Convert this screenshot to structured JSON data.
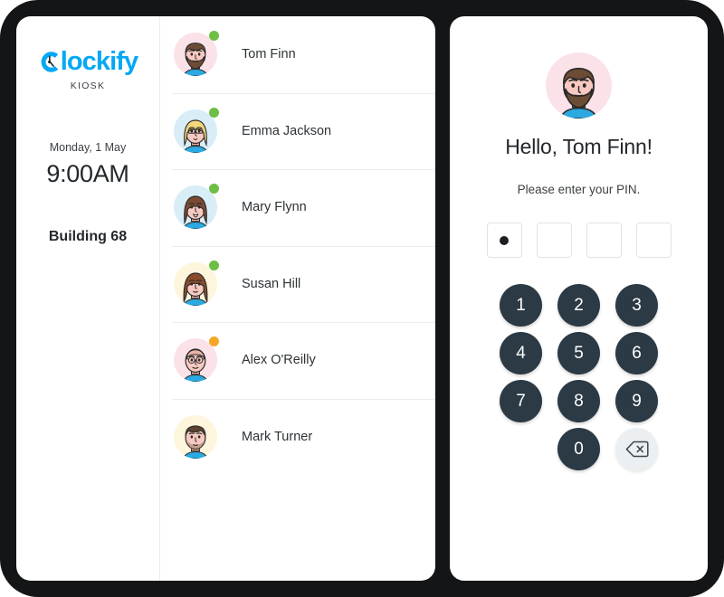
{
  "brand": {
    "logo_text": "lockify",
    "logo_mark": "clockify-clock-icon",
    "sub_label": "KIOSK",
    "accent_color": "#03a9f4"
  },
  "info_pane": {
    "date": "Monday, 1 May",
    "time": "9:00AM",
    "location": "Building 68"
  },
  "user_list": {
    "users": [
      {
        "name": "Tom Finn",
        "status": "online",
        "status_color": "#6dbe45",
        "avatar_bg": "#fbe2e9",
        "avatar": "avatar-bearded-man-brown-hair"
      },
      {
        "name": "Emma Jackson",
        "status": "online",
        "status_color": "#6dbe45",
        "avatar_bg": "#d9edf7",
        "avatar": "avatar-blonde-woman-glasses"
      },
      {
        "name": "Mary Flynn",
        "status": "online",
        "status_color": "#6dbe45",
        "avatar_bg": "#d9edf7",
        "avatar": "avatar-brown-haired-woman"
      },
      {
        "name": "Susan Hill",
        "status": "online",
        "status_color": "#6dbe45",
        "avatar_bg": "#fdf6dd",
        "avatar": "avatar-auburn-haired-woman"
      },
      {
        "name": "Alex O'Reilly",
        "status": "away",
        "status_color": "#f5a623",
        "avatar_bg": "#fbe2e9",
        "avatar": "avatar-bald-man-glasses"
      },
      {
        "name": "Mark Turner",
        "status": "offline",
        "status_color": "",
        "avatar_bg": "#fdf6dd",
        "avatar": "avatar-short-hair-man-stubble"
      }
    ]
  },
  "pin_panel": {
    "avatar": "avatar-bearded-man-brown-hair",
    "avatar_bg": "#fbe2e9",
    "greeting": "Hello, Tom Finn!",
    "prompt": "Please enter your PIN.",
    "pin_length": 4,
    "pin_entered": 1,
    "keypad": [
      "1",
      "2",
      "3",
      "4",
      "5",
      "6",
      "7",
      "8",
      "9",
      "0"
    ],
    "backspace_label": "backspace-icon",
    "key_color": "#2b3a45",
    "backspace_color": "#eceff1"
  }
}
